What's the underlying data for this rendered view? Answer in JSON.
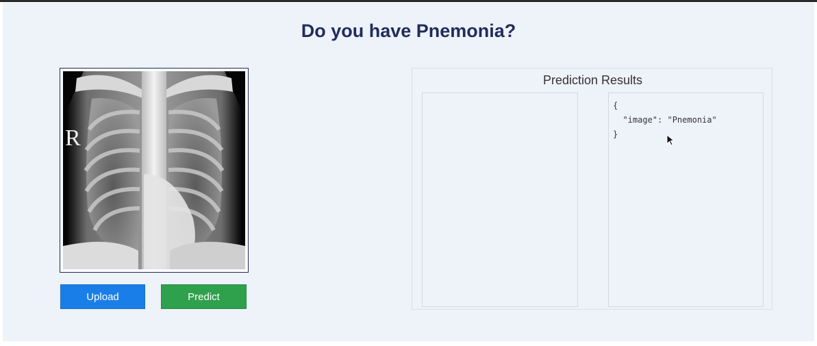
{
  "header": {
    "title": "Do you have Pnemonia?"
  },
  "image_panel": {
    "image_marker": "R"
  },
  "buttons": {
    "upload_label": "Upload",
    "predict_label": "Predict",
    "upload_color": "#1a7ee8",
    "predict_color": "#2fa04c"
  },
  "results": {
    "title": "Prediction Results",
    "json_text": "{\n  \"image\": \"Pnemonia\"\n}"
  },
  "colors": {
    "title": "#1f2d5c",
    "background": "#eef2f9"
  }
}
